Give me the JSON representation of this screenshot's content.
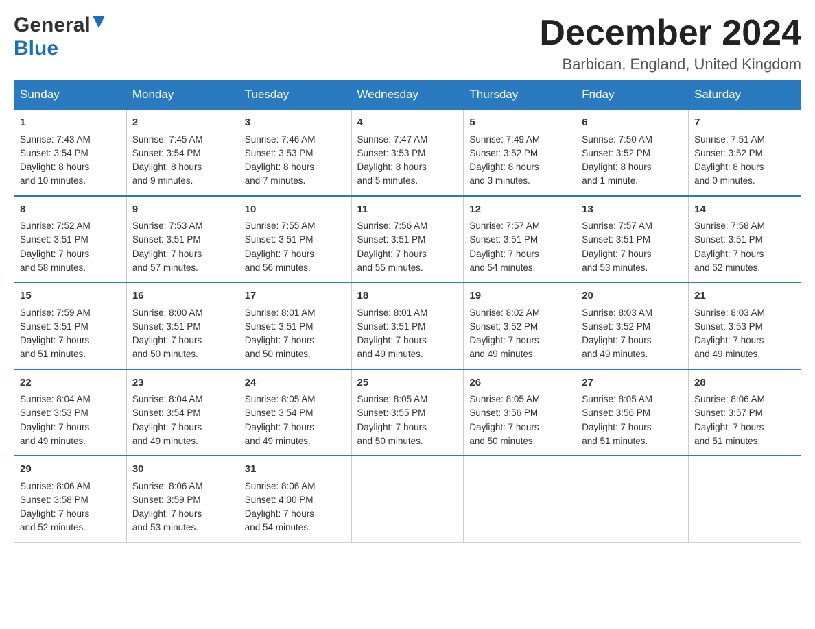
{
  "header": {
    "logo_general": "General",
    "logo_blue": "Blue",
    "month_title": "December 2024",
    "location": "Barbican, England, United Kingdom"
  },
  "weekdays": [
    "Sunday",
    "Monday",
    "Tuesday",
    "Wednesday",
    "Thursday",
    "Friday",
    "Saturday"
  ],
  "weeks": [
    [
      {
        "day": "1",
        "sunrise": "7:43 AM",
        "sunset": "3:54 PM",
        "daylight": "8 hours and 10 minutes."
      },
      {
        "day": "2",
        "sunrise": "7:45 AM",
        "sunset": "3:54 PM",
        "daylight": "8 hours and 9 minutes."
      },
      {
        "day": "3",
        "sunrise": "7:46 AM",
        "sunset": "3:53 PM",
        "daylight": "8 hours and 7 minutes."
      },
      {
        "day": "4",
        "sunrise": "7:47 AM",
        "sunset": "3:53 PM",
        "daylight": "8 hours and 5 minutes."
      },
      {
        "day": "5",
        "sunrise": "7:49 AM",
        "sunset": "3:52 PM",
        "daylight": "8 hours and 3 minutes."
      },
      {
        "day": "6",
        "sunrise": "7:50 AM",
        "sunset": "3:52 PM",
        "daylight": "8 hours and 1 minute."
      },
      {
        "day": "7",
        "sunrise": "7:51 AM",
        "sunset": "3:52 PM",
        "daylight": "8 hours and 0 minutes."
      }
    ],
    [
      {
        "day": "8",
        "sunrise": "7:52 AM",
        "sunset": "3:51 PM",
        "daylight": "7 hours and 58 minutes."
      },
      {
        "day": "9",
        "sunrise": "7:53 AM",
        "sunset": "3:51 PM",
        "daylight": "7 hours and 57 minutes."
      },
      {
        "day": "10",
        "sunrise": "7:55 AM",
        "sunset": "3:51 PM",
        "daylight": "7 hours and 56 minutes."
      },
      {
        "day": "11",
        "sunrise": "7:56 AM",
        "sunset": "3:51 PM",
        "daylight": "7 hours and 55 minutes."
      },
      {
        "day": "12",
        "sunrise": "7:57 AM",
        "sunset": "3:51 PM",
        "daylight": "7 hours and 54 minutes."
      },
      {
        "day": "13",
        "sunrise": "7:57 AM",
        "sunset": "3:51 PM",
        "daylight": "7 hours and 53 minutes."
      },
      {
        "day": "14",
        "sunrise": "7:58 AM",
        "sunset": "3:51 PM",
        "daylight": "7 hours and 52 minutes."
      }
    ],
    [
      {
        "day": "15",
        "sunrise": "7:59 AM",
        "sunset": "3:51 PM",
        "daylight": "7 hours and 51 minutes."
      },
      {
        "day": "16",
        "sunrise": "8:00 AM",
        "sunset": "3:51 PM",
        "daylight": "7 hours and 50 minutes."
      },
      {
        "day": "17",
        "sunrise": "8:01 AM",
        "sunset": "3:51 PM",
        "daylight": "7 hours and 50 minutes."
      },
      {
        "day": "18",
        "sunrise": "8:01 AM",
        "sunset": "3:51 PM",
        "daylight": "7 hours and 49 minutes."
      },
      {
        "day": "19",
        "sunrise": "8:02 AM",
        "sunset": "3:52 PM",
        "daylight": "7 hours and 49 minutes."
      },
      {
        "day": "20",
        "sunrise": "8:03 AM",
        "sunset": "3:52 PM",
        "daylight": "7 hours and 49 minutes."
      },
      {
        "day": "21",
        "sunrise": "8:03 AM",
        "sunset": "3:53 PM",
        "daylight": "7 hours and 49 minutes."
      }
    ],
    [
      {
        "day": "22",
        "sunrise": "8:04 AM",
        "sunset": "3:53 PM",
        "daylight": "7 hours and 49 minutes."
      },
      {
        "day": "23",
        "sunrise": "8:04 AM",
        "sunset": "3:54 PM",
        "daylight": "7 hours and 49 minutes."
      },
      {
        "day": "24",
        "sunrise": "8:05 AM",
        "sunset": "3:54 PM",
        "daylight": "7 hours and 49 minutes."
      },
      {
        "day": "25",
        "sunrise": "8:05 AM",
        "sunset": "3:55 PM",
        "daylight": "7 hours and 50 minutes."
      },
      {
        "day": "26",
        "sunrise": "8:05 AM",
        "sunset": "3:56 PM",
        "daylight": "7 hours and 50 minutes."
      },
      {
        "day": "27",
        "sunrise": "8:05 AM",
        "sunset": "3:56 PM",
        "daylight": "7 hours and 51 minutes."
      },
      {
        "day": "28",
        "sunrise": "8:06 AM",
        "sunset": "3:57 PM",
        "daylight": "7 hours and 51 minutes."
      }
    ],
    [
      {
        "day": "29",
        "sunrise": "8:06 AM",
        "sunset": "3:58 PM",
        "daylight": "7 hours and 52 minutes."
      },
      {
        "day": "30",
        "sunrise": "8:06 AM",
        "sunset": "3:59 PM",
        "daylight": "7 hours and 53 minutes."
      },
      {
        "day": "31",
        "sunrise": "8:06 AM",
        "sunset": "4:00 PM",
        "daylight": "7 hours and 54 minutes."
      },
      null,
      null,
      null,
      null
    ]
  ]
}
